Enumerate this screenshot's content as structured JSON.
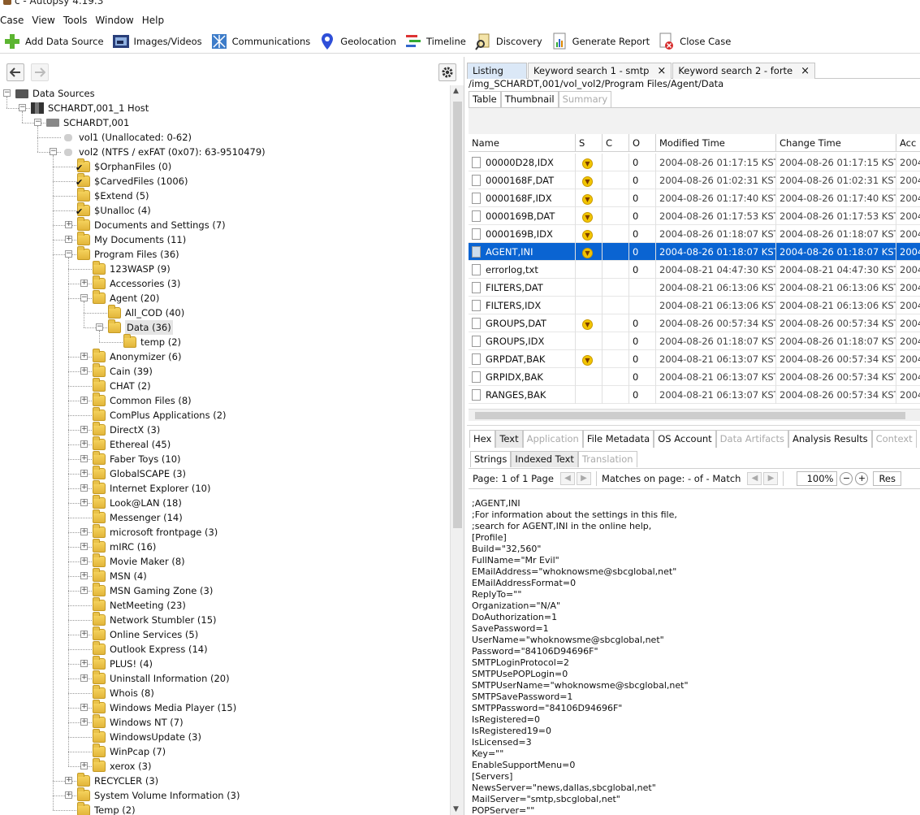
{
  "window": {
    "title": "c - Autopsy 4.19.3"
  },
  "menu": [
    "Case",
    "View",
    "Tools",
    "Window",
    "Help"
  ],
  "toolbar": [
    {
      "label": "Add Data Source",
      "icon": "plus-icon"
    },
    {
      "label": "Images/Videos",
      "icon": "images-icon"
    },
    {
      "label": "Communications",
      "icon": "communications-icon"
    },
    {
      "label": "Geolocation",
      "icon": "map-pin-icon"
    },
    {
      "label": "Timeline",
      "icon": "timeline-icon"
    },
    {
      "label": "Discovery",
      "icon": "discovery-icon"
    },
    {
      "label": "Generate Report",
      "icon": "report-icon"
    },
    {
      "label": "Close Case",
      "icon": "close-case-icon"
    }
  ],
  "tree": [
    {
      "label": "Data Sources",
      "level": 0,
      "toggle": "-",
      "icon": "disk"
    },
    {
      "label": "SCHARDT,001_1 Host",
      "level": 1,
      "toggle": "-",
      "icon": "host"
    },
    {
      "label": "SCHARDT,001",
      "level": 2,
      "toggle": "-",
      "icon": "image"
    },
    {
      "label": "vol1 (Unallocated: 0-62)",
      "level": 3,
      "toggle": "",
      "icon": "volume"
    },
    {
      "label": "vol2 (NTFS / exFAT (0x07): 63-9510479)",
      "level": 3,
      "toggle": "-",
      "icon": "volume"
    },
    {
      "label": "$OrphanFiles (0)",
      "level": 4,
      "toggle": "",
      "icon": "folder-check"
    },
    {
      "label": "$CarvedFiles (1006)",
      "level": 4,
      "toggle": "",
      "icon": "folder-check"
    },
    {
      "label": "$Extend (5)",
      "level": 4,
      "toggle": "",
      "icon": "folder"
    },
    {
      "label": "$Unalloc (4)",
      "level": 4,
      "toggle": "",
      "icon": "folder-check"
    },
    {
      "label": "Documents and Settings (7)",
      "level": 4,
      "toggle": "+",
      "icon": "folder"
    },
    {
      "label": "My Documents (11)",
      "level": 4,
      "toggle": "+",
      "icon": "folder"
    },
    {
      "label": "Program Files (36)",
      "level": 4,
      "toggle": "-",
      "icon": "folder"
    },
    {
      "label": "123WASP (9)",
      "level": 5,
      "toggle": "",
      "icon": "folder"
    },
    {
      "label": "Accessories (3)",
      "level": 5,
      "toggle": "+",
      "icon": "folder"
    },
    {
      "label": "Agent (20)",
      "level": 5,
      "toggle": "-",
      "icon": "folder"
    },
    {
      "label": "All_COD (40)",
      "level": 6,
      "toggle": "",
      "icon": "folder"
    },
    {
      "label": "Data (36)",
      "level": 6,
      "toggle": "-",
      "icon": "folder",
      "selected": true
    },
    {
      "label": "temp (2)",
      "level": 7,
      "toggle": "",
      "icon": "folder"
    },
    {
      "label": "Anonymizer (6)",
      "level": 5,
      "toggle": "+",
      "icon": "folder"
    },
    {
      "label": "Cain (39)",
      "level": 5,
      "toggle": "+",
      "icon": "folder"
    },
    {
      "label": "CHAT (2)",
      "level": 5,
      "toggle": "",
      "icon": "folder"
    },
    {
      "label": "Common Files (8)",
      "level": 5,
      "toggle": "+",
      "icon": "folder"
    },
    {
      "label": "ComPlus Applications (2)",
      "level": 5,
      "toggle": "",
      "icon": "folder"
    },
    {
      "label": "DirectX (3)",
      "level": 5,
      "toggle": "+",
      "icon": "folder"
    },
    {
      "label": "Ethereal (45)",
      "level": 5,
      "toggle": "+",
      "icon": "folder"
    },
    {
      "label": "Faber Toys (10)",
      "level": 5,
      "toggle": "+",
      "icon": "folder"
    },
    {
      "label": "GlobalSCAPE (3)",
      "level": 5,
      "toggle": "+",
      "icon": "folder"
    },
    {
      "label": "Internet Explorer (10)",
      "level": 5,
      "toggle": "+",
      "icon": "folder"
    },
    {
      "label": "Look@LAN (18)",
      "level": 5,
      "toggle": "+",
      "icon": "folder"
    },
    {
      "label": "Messenger (14)",
      "level": 5,
      "toggle": "",
      "icon": "folder"
    },
    {
      "label": "microsoft frontpage (3)",
      "level": 5,
      "toggle": "+",
      "icon": "folder"
    },
    {
      "label": "mIRC (16)",
      "level": 5,
      "toggle": "+",
      "icon": "folder"
    },
    {
      "label": "Movie Maker (8)",
      "level": 5,
      "toggle": "+",
      "icon": "folder"
    },
    {
      "label": "MSN (4)",
      "level": 5,
      "toggle": "+",
      "icon": "folder"
    },
    {
      "label": "MSN Gaming Zone (3)",
      "level": 5,
      "toggle": "+",
      "icon": "folder"
    },
    {
      "label": "NetMeeting (23)",
      "level": 5,
      "toggle": "",
      "icon": "folder"
    },
    {
      "label": "Network Stumbler (15)",
      "level": 5,
      "toggle": "",
      "icon": "folder"
    },
    {
      "label": "Online Services (5)",
      "level": 5,
      "toggle": "+",
      "icon": "folder"
    },
    {
      "label": "Outlook Express (14)",
      "level": 5,
      "toggle": "",
      "icon": "folder"
    },
    {
      "label": "PLUS! (4)",
      "level": 5,
      "toggle": "+",
      "icon": "folder"
    },
    {
      "label": "Uninstall Information (20)",
      "level": 5,
      "toggle": "+",
      "icon": "folder"
    },
    {
      "label": "Whois (8)",
      "level": 5,
      "toggle": "",
      "icon": "folder"
    },
    {
      "label": "Windows Media Player (15)",
      "level": 5,
      "toggle": "+",
      "icon": "folder"
    },
    {
      "label": "Windows NT (7)",
      "level": 5,
      "toggle": "+",
      "icon": "folder"
    },
    {
      "label": "WindowsUpdate (3)",
      "level": 5,
      "toggle": "",
      "icon": "folder"
    },
    {
      "label": "WinPcap (7)",
      "level": 5,
      "toggle": "",
      "icon": "folder"
    },
    {
      "label": "xerox (3)",
      "level": 5,
      "toggle": "+",
      "icon": "folder"
    },
    {
      "label": "RECYCLER (3)",
      "level": 4,
      "toggle": "+",
      "icon": "folder"
    },
    {
      "label": "System Volume Information (3)",
      "level": 4,
      "toggle": "+",
      "icon": "folder"
    },
    {
      "label": "Temp (2)",
      "level": 4,
      "toggle": "",
      "icon": "folder"
    }
  ],
  "result_tabs": [
    {
      "label": "Listing",
      "closable": false,
      "active": true
    },
    {
      "label": "Keyword search 1 - smtp",
      "closable": true,
      "active": false
    },
    {
      "label": "Keyword search 2 - forte",
      "closable": true,
      "active": false
    }
  ],
  "path": "/img_SCHARDT,001/vol_vol2/Program Files/Agent/Data",
  "view_tabs": [
    {
      "label": "Table",
      "enabled": true
    },
    {
      "label": "Thumbnail",
      "enabled": true
    },
    {
      "label": "Summary",
      "enabled": false
    }
  ],
  "table": {
    "columns": [
      "Name",
      "S",
      "C",
      "O",
      "Modified Time",
      "Change Time",
      "Acc"
    ],
    "rows": [
      {
        "name": "00000D28,IDX",
        "score": true,
        "c": "",
        "o": "0",
        "modified": "2004-08-26 01:17:15 KST",
        "change": "2004-08-26 01:17:15 KST",
        "acc": "2004"
      },
      {
        "name": "0000168F,DAT",
        "score": true,
        "c": "",
        "o": "0",
        "modified": "2004-08-26 01:02:31 KST",
        "change": "2004-08-26 01:02:31 KST",
        "acc": "2004"
      },
      {
        "name": "0000168F,IDX",
        "score": true,
        "c": "",
        "o": "0",
        "modified": "2004-08-26 01:17:40 KST",
        "change": "2004-08-26 01:17:40 KST",
        "acc": "2004"
      },
      {
        "name": "0000169B,DAT",
        "score": true,
        "c": "",
        "o": "0",
        "modified": "2004-08-26 01:17:53 KST",
        "change": "2004-08-26 01:17:53 KST",
        "acc": "2004"
      },
      {
        "name": "0000169B,IDX",
        "score": true,
        "c": "",
        "o": "0",
        "modified": "2004-08-26 01:18:07 KST",
        "change": "2004-08-26 01:18:07 KST",
        "acc": "2004"
      },
      {
        "name": "AGENT,INI",
        "score": true,
        "c": "",
        "o": "0",
        "modified": "2004-08-26 01:18:07 KST",
        "change": "2004-08-26 01:18:07 KST",
        "acc": "2004",
        "selected": true
      },
      {
        "name": "errorlog,txt",
        "score": false,
        "c": "",
        "o": "0",
        "modified": "2004-08-21 04:47:30 KST",
        "change": "2004-08-21 04:47:30 KST",
        "acc": "2004"
      },
      {
        "name": "FILTERS,DAT",
        "score": false,
        "c": "",
        "o": "",
        "modified": "2004-08-21 06:13:06 KST",
        "change": "2004-08-21 06:13:06 KST",
        "acc": "2004"
      },
      {
        "name": "FILTERS,IDX",
        "score": false,
        "c": "",
        "o": "",
        "modified": "2004-08-21 06:13:06 KST",
        "change": "2004-08-21 06:13:06 KST",
        "acc": "2004"
      },
      {
        "name": "GROUPS,DAT",
        "score": true,
        "c": "",
        "o": "0",
        "modified": "2004-08-26 00:57:34 KST",
        "change": "2004-08-26 00:57:34 KST",
        "acc": "2004"
      },
      {
        "name": "GROUPS,IDX",
        "score": false,
        "c": "",
        "o": "0",
        "modified": "2004-08-26 01:18:07 KST",
        "change": "2004-08-26 01:18:07 KST",
        "acc": "2004"
      },
      {
        "name": "GRPDAT,BAK",
        "score": true,
        "c": "",
        "o": "0",
        "modified": "2004-08-21 06:13:07 KST",
        "change": "2004-08-26 00:57:34 KST",
        "acc": "2004"
      },
      {
        "name": "GRPIDX,BAK",
        "score": false,
        "c": "",
        "o": "0",
        "modified": "2004-08-21 06:13:07 KST",
        "change": "2004-08-26 00:57:34 KST",
        "acc": "2004"
      },
      {
        "name": "RANGES,BAK",
        "score": false,
        "c": "",
        "o": "0",
        "modified": "2004-08-21 06:13:07 KST",
        "change": "2004-08-26 00:57:34 KST",
        "acc": "2004"
      }
    ]
  },
  "content_tabs": [
    {
      "label": "Hex",
      "state": "normal"
    },
    {
      "label": "Text",
      "state": "active"
    },
    {
      "label": "Application",
      "state": "dim"
    },
    {
      "label": "File Metadata",
      "state": "normal"
    },
    {
      "label": "OS Account",
      "state": "normal"
    },
    {
      "label": "Data Artifacts",
      "state": "dim"
    },
    {
      "label": "Analysis Results",
      "state": "normal"
    },
    {
      "label": "Context",
      "state": "dim"
    }
  ],
  "text_tabs": [
    {
      "label": "Strings",
      "state": "normal"
    },
    {
      "label": "Indexed Text",
      "state": "active"
    },
    {
      "label": "Translation",
      "state": "dim"
    }
  ],
  "pagebar": {
    "page_label": "Page:",
    "page_value": "1",
    "of_label": "of",
    "total_value": "1",
    "page_word": "Page",
    "matches_label": "Matches on page:",
    "matches_value": "-",
    "of2_label": "of",
    "match_total": "-",
    "match_word": "Match",
    "zoom": "100%",
    "reset_label": "Res"
  },
  "text_content": [
    ";AGENT,INI",
    ";For information about the settings in this file,",
    ";search for AGENT,INI in the online help,",
    "[Profile]",
    "Build=\"32,560\"",
    "FullName=\"Mr Evil\"",
    "EMailAddress=\"whoknowsme@sbcglobal,net\"",
    "EMailAddressFormat=0",
    "ReplyTo=\"\"",
    "Organization=\"N/A\"",
    "DoAuthorization=1",
    "SavePassword=1",
    "UserName=\"whoknowsme@sbcglobal,net\"",
    "Password=\"84106D94696F\"",
    "SMTPLoginProtocol=2",
    "SMTPUsePOPLogin=0",
    "SMTPUserName=\"whoknowsme@sbcglobal,net\"",
    "SMTPSavePassword=1",
    "SMTPPassword=\"84106D94696F\"",
    "IsRegistered=0",
    "IsRegistered19=0",
    "IsLicensed=3",
    "Key=\"\"",
    "EnableSupportMenu=0",
    "[Servers]",
    "NewsServer=\"news,dallas,sbcglobal,net\"",
    "MailServer=\"smtp,sbcglobal,net\"",
    "POPServer=\"\""
  ]
}
